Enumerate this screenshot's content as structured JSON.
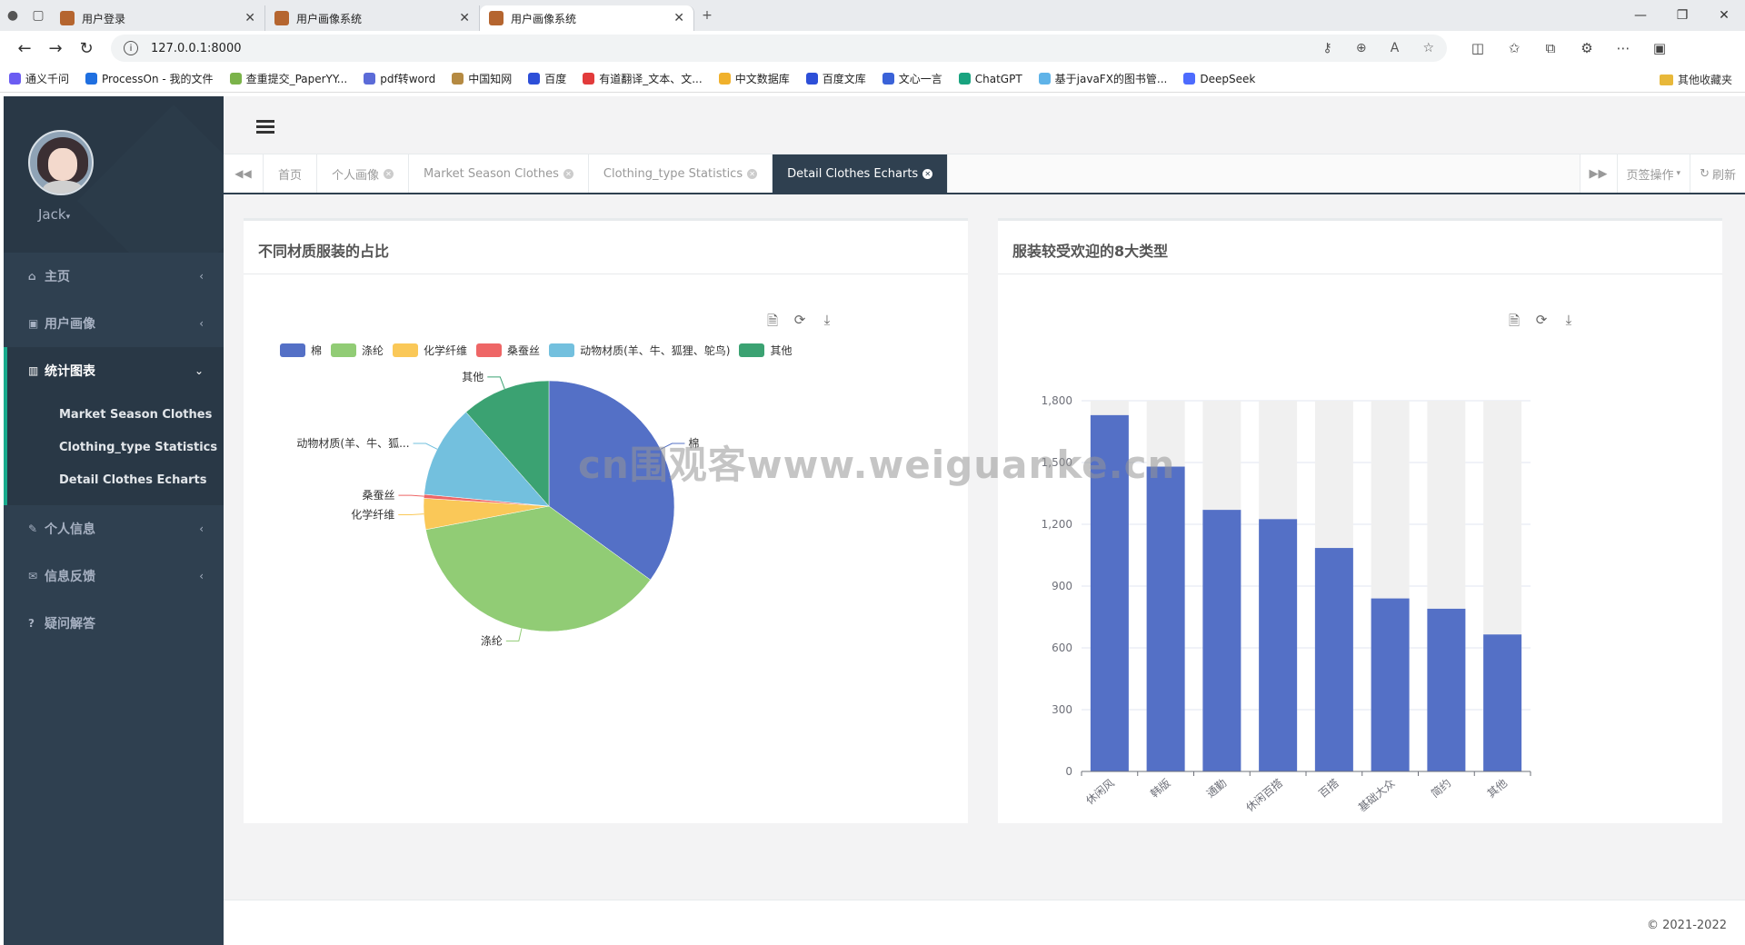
{
  "browser": {
    "tabs": [
      {
        "title": "用户登录"
      },
      {
        "title": "用户画像系统"
      },
      {
        "title": "用户画像系统"
      }
    ],
    "new_tab": "+",
    "url": "127.0.0.1:8000",
    "bookmarks": [
      {
        "label": "通义千问",
        "color": "#6b5cf2"
      },
      {
        "label": "ProcessOn - 我的文件",
        "color": "#1f6fe0"
      },
      {
        "label": "查重提交_PaperYY...",
        "color": "#7bb34a"
      },
      {
        "label": "pdf转word",
        "color": "#5b6bd8"
      },
      {
        "label": "中国知网",
        "color": "#b58a42"
      },
      {
        "label": "百度",
        "color": "#2d4fd8"
      },
      {
        "label": "有道翻译_文本、文...",
        "color": "#e23b3b"
      },
      {
        "label": "中文数据库",
        "color": "#f0b12c"
      },
      {
        "label": "百度文库",
        "color": "#2d4fd8"
      },
      {
        "label": "文心一言",
        "color": "#3a62d8"
      },
      {
        "label": "ChatGPT",
        "color": "#19a37f"
      },
      {
        "label": "基于javaFX的图书管...",
        "color": "#5fb3e8"
      },
      {
        "label": "DeepSeek",
        "color": "#4d6bfe"
      }
    ],
    "other_bookmarks": "其他收藏夹"
  },
  "sidebar": {
    "username": "Jack",
    "menu": [
      {
        "icon": "home-icon",
        "glyph": "⌂",
        "label": "主页"
      },
      {
        "icon": "image-icon",
        "glyph": "▣",
        "label": "用户画像"
      },
      {
        "icon": "bar-chart-icon",
        "glyph": "▥",
        "label": "统计图表"
      },
      {
        "icon": "edit-icon",
        "glyph": "✎",
        "label": "个人信息"
      },
      {
        "icon": "envelope-icon",
        "glyph": "✉",
        "label": "信息反馈"
      },
      {
        "icon": "question-icon",
        "glyph": "?",
        "label": "疑问解答"
      }
    ],
    "submenu": [
      "Market Season Clothes",
      "Clothing_type Statistics",
      "Detail Clothes Echarts"
    ]
  },
  "page_tabs": [
    "首页",
    "个人画像",
    "Market Season Clothes",
    "Clothing_type Statistics",
    "Detail Clothes Echarts"
  ],
  "tab_actions": {
    "ops": "页签操作",
    "refresh": "刷新"
  },
  "panels": {
    "left_title": "不同材质服装的占比",
    "right_title": "服装较受欢迎的8大类型"
  },
  "watermark": "cn围观客www.weiguanke.cn",
  "footer": "© 2021-2022",
  "colors": {
    "sidebar": "#2f4050",
    "accent": "#19aa8d",
    "bar": "#5470c6"
  },
  "chart_data": [
    {
      "type": "pie",
      "title": "不同材质服装的占比",
      "legend": [
        "棉",
        "涤纶",
        "化学纤维",
        "桑蚕丝",
        "动物材质(羊、牛、狐狸、鸵鸟)",
        "其他"
      ],
      "slice_labels": [
        "棉",
        "涤纶",
        "化学纤维",
        "桑蚕丝",
        "动物材质(羊、牛、狐...",
        "其他"
      ],
      "values": [
        35.0,
        37.0,
        4.0,
        0.5,
        12.0,
        11.5
      ],
      "colors": [
        "#5470c6",
        "#91cc75",
        "#fac858",
        "#ee6666",
        "#73c0de",
        "#3ba272"
      ],
      "legend_position": "top-left"
    },
    {
      "type": "bar",
      "title": "服装较受欢迎的8大类型",
      "categories": [
        "休闲风",
        "韩版",
        "通勤",
        "休闲百搭",
        "百搭",
        "基础大众",
        "简约",
        "其他"
      ],
      "values": [
        1730,
        1480,
        1270,
        1225,
        1085,
        840,
        790,
        665
      ],
      "background_max": 1800,
      "ylim": [
        0,
        1800
      ],
      "yticks": [
        "0",
        "300",
        "600",
        "900",
        "1,200",
        "1,500",
        "1,800"
      ],
      "grid": true
    }
  ]
}
